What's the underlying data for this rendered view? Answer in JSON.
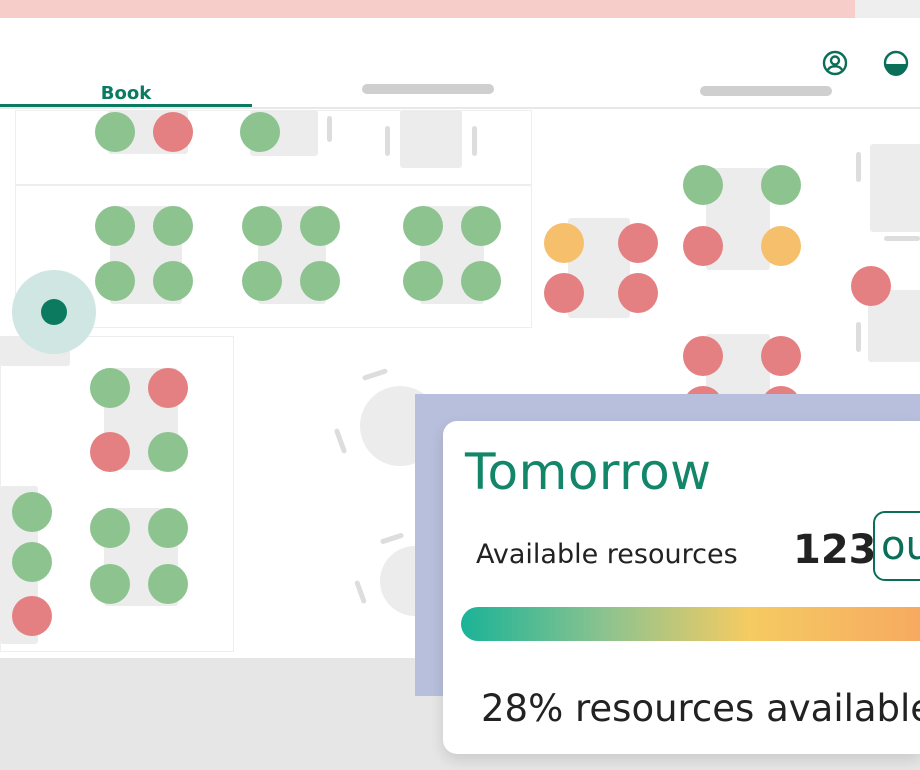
{
  "header": {
    "profile_icon": "user-circle-icon",
    "logo_icon": "brand-logo-icon"
  },
  "tabs": [
    {
      "label": "Book",
      "active": true
    },
    {
      "label": "",
      "active": false
    },
    {
      "label": "",
      "active": false
    }
  ],
  "seat_colors": {
    "available": "#8cc38f",
    "booked": "#e48081",
    "partial": "#f5bf6b",
    "accent": "#0a7a62"
  },
  "panel": {
    "title": "Tomorrow",
    "label": "Available resources",
    "count": "123",
    "count_suffix": "ou",
    "percent_text": "28% resources available",
    "availability_fraction": 0.28
  }
}
